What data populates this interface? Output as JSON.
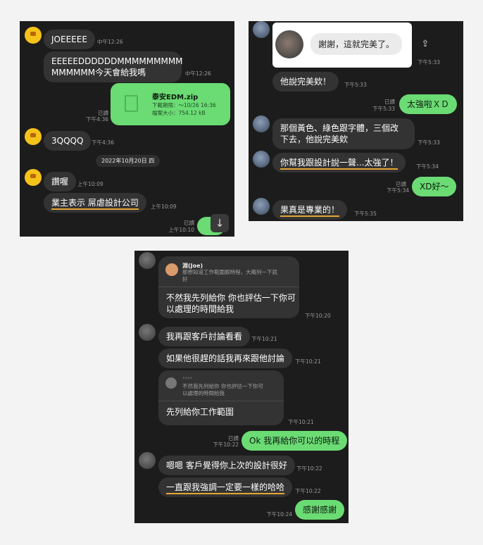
{
  "panel1": {
    "m1": {
      "text": "JOEEEEE",
      "time": "中午12:26"
    },
    "m2": {
      "text": "EEEEEDDDDDDMMMMMMMMM\nMMMMMM今天會給我嗎",
      "time": "中午12:26"
    },
    "file": {
      "name": "泰安EDM.zip",
      "expiry": "下載期限：～10/26 16:36",
      "size": "檔案大小：754.12 kB",
      "read": "已讀",
      "time": "下午4:36"
    },
    "m3": {
      "text": "3QQQQ",
      "time": "下午4:36"
    },
    "date": "2022年10月20日 四",
    "m4": {
      "text": "讚喔",
      "time": "上午10:09"
    },
    "m5": {
      "text": "業主表示  屌虐設計公司",
      "time": "上午10:09"
    },
    "m6": {
      "read": "已讀",
      "time": "上午10:10"
    }
  },
  "panel2": {
    "quote": {
      "text": "謝謝，這就完美了。",
      "time": "下午5:33"
    },
    "m1": {
      "text": "他說完美欸！",
      "time": "下午5:33"
    },
    "m2": {
      "text": "太強啦ＸＤ",
      "read": "已讀",
      "time": "下午5:33"
    },
    "m3": {
      "text": "那個黃色、綠色跟字體，三個改\n下去，他說完美欸",
      "time": "下午5:33"
    },
    "m4": {
      "text": "你幫我跟設計說一聲...太強了！",
      "time": "下午5:34"
    },
    "m5": {
      "text": "XD好～",
      "read": "已讀",
      "time": "下午5:34"
    },
    "m6": {
      "text": "果真是專業的！",
      "time": "下午5:35"
    }
  },
  "panel3": {
    "reply1": {
      "author": "淵(Joe)",
      "quoted": "那想知道工作範圍跟時程，大概列一下就\n好",
      "text": "不然我先列給你 你也評估一下你可\n以處理的時間給我",
      "time": "下午10:20"
    },
    "m1": {
      "text": "我再跟客戶討論看看",
      "time": "下午10:21"
    },
    "m2": {
      "text": "如果他很趕的話我再來跟他討論",
      "time": "下午10:21"
    },
    "reply2": {
      "author": "****",
      "quoted": "不然我先列給你 你也評估一下你可\n以處理的時間給我",
      "text": "先列給你工作範圍",
      "time": "下午10:21"
    },
    "m3": {
      "text": "Ok 我再給你可以的時程",
      "read": "已讀",
      "time": "下午10:22"
    },
    "m4": {
      "text": "嗯嗯 客戶覺得你上次的設計很好",
      "time": "下午10:22"
    },
    "m5": {
      "text": "一直跟我強調一定要一樣的哈哈",
      "time": "下午10:22"
    },
    "m6": {
      "text": "感謝感謝",
      "time": "下午10:24"
    }
  },
  "icons": {
    "scroll_down": "arrow-down-icon",
    "share": "share-icon",
    "file": "file-icon"
  }
}
